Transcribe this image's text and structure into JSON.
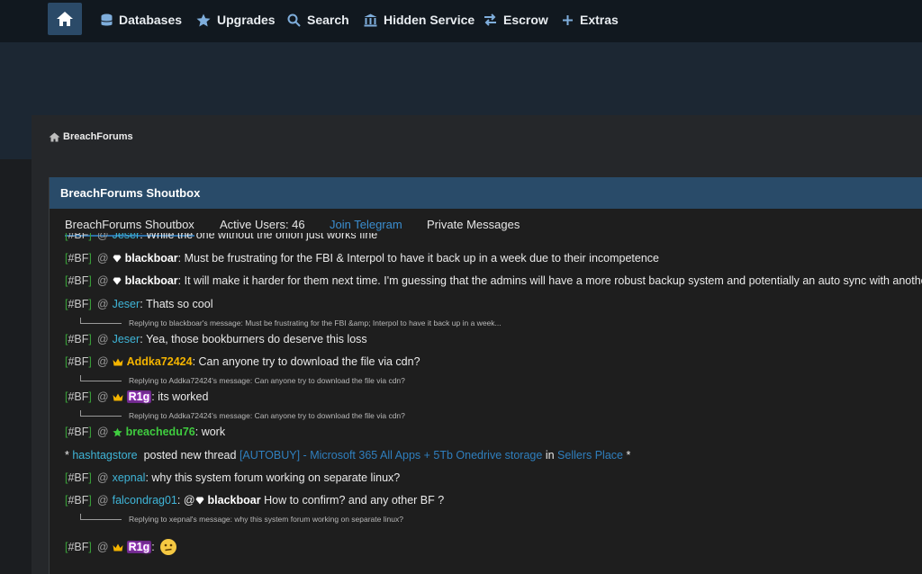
{
  "nav": {
    "items": [
      {
        "label": "Databases",
        "icon": "database-icon"
      },
      {
        "label": "Upgrades",
        "icon": "star-icon"
      },
      {
        "label": "Search",
        "icon": "search-icon"
      },
      {
        "label": "Hidden Service",
        "icon": "building-icon"
      },
      {
        "label": "Escrow",
        "icon": "exchange-icon"
      },
      {
        "label": "Extras",
        "icon": "plus-icon"
      }
    ]
  },
  "breadcrumb": {
    "label": "BreachForums"
  },
  "shoutbox": {
    "title": "BreachForums Shoutbox",
    "tabs": [
      {
        "label": "BreachForums Shoutbox"
      },
      {
        "label": "Active Users: 46"
      },
      {
        "label": "Join Telegram"
      },
      {
        "label": "Private Messages"
      }
    ],
    "tag_open": "[",
    "tag_text": "#BF",
    "tag_close": "]",
    "at": "@",
    "messages": [
      {
        "user": "Jeser",
        "text": "While the one without the onion just works fine"
      },
      {
        "user": "blackboar",
        "text": "Must be frustrating for the FBI & Interpol to have it back up in a week due to their incompetence"
      },
      {
        "user": "blackboar",
        "text": "It will make it harder for them next time. I'm guessing that the admins will have a more robust backup system and potentially an auto sync with another host"
      },
      {
        "user": "Jeser",
        "text": "Thats so cool"
      },
      {
        "reply": "Replying to blackboar's message: Must be frustrating for the FBI &amp; Interpol to have it back up in a week..."
      },
      {
        "user": "Jeser",
        "text": "Yea, those bookburners do deserve this loss"
      },
      {
        "user": "Addka72424",
        "text": "Can anyone try to download the file via cdn?"
      },
      {
        "reply": "Replying to Addka72424's message: Can anyone try to download the file via cdn?"
      },
      {
        "user": "R1g",
        "text": "its worked"
      },
      {
        "reply": "Replying to Addka72424's message: Can anyone try to download the file via cdn?"
      },
      {
        "user": "breachedu76",
        "text": "work"
      },
      {
        "system_user": "hashtagstore",
        "system_text": "posted new thread",
        "thread": "[AUTOBUY] - Microsoft 365 All Apps + 5Tb Onedrive storage",
        "in": "in",
        "forum": "Sellers Place",
        "star": "*"
      },
      {
        "user": "xepnal",
        "text": "why this system forum working on separate linux?"
      },
      {
        "user": "falcondrag01",
        "mention_at": "@",
        "mention": "blackboar",
        "text": "How to confirm? and any other BF ?"
      },
      {
        "reply": "Replying to xepnal's message: why this system forum working on separate linux?"
      },
      {
        "user": "R1g",
        "text": ""
      }
    ]
  },
  "colors": {
    "accent": "#294b69",
    "link": "#3b8ed0",
    "gold": "#f4b400",
    "green": "#3fcc3f"
  }
}
